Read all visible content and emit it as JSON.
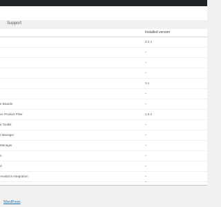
{
  "tabs": [
    "Support"
  ],
  "table": {
    "header_version": "Installed version",
    "rows": [
      {
        "name": "",
        "version": "3.2.4"
      },
      {
        "name": "",
        "version": "–"
      },
      {
        "name": "",
        "version": "–"
      },
      {
        "name": "",
        "version": "–"
      },
      {
        "name": "",
        "version": "3.1"
      },
      {
        "name": "",
        "version": "–"
      },
      {
        "name": "e Brands",
        "version": "–"
      },
      {
        "name": "ce Product Filter",
        "version": "1.0.2"
      },
      {
        "name": "e Toolkit",
        "version": "–"
      },
      {
        "name": "t Manager",
        "version": "–"
      },
      {
        "name": "Manager",
        "version": "–"
      },
      {
        "name": "n",
        "version": "–"
      },
      {
        "name": "d",
        "version": "–"
      },
      {
        "name": "Analytics Integration",
        "version": "–"
      },
      {
        "name": "",
        "version": "–"
      }
    ]
  },
  "footer": {
    "link": "WordPress"
  }
}
